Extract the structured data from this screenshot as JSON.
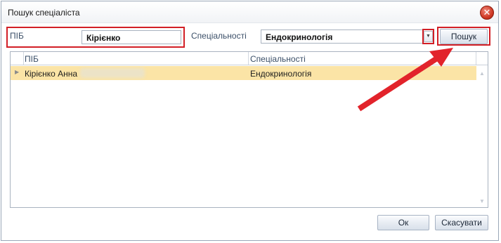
{
  "window": {
    "title": "Пошук спеціаліста",
    "close_icon": "close-icon"
  },
  "search": {
    "name_label": "ПІБ",
    "name_value": "Кірієнко",
    "specialty_label": "Спеціальності",
    "specialty_value": "Ендокринологія",
    "search_button": "Пошук"
  },
  "grid": {
    "columns": [
      "ПІБ",
      "Спеціальності"
    ],
    "rows": [
      {
        "name": "Кірієнко Анна",
        "specialty": "Ендокринологія",
        "selected": true
      }
    ]
  },
  "footer": {
    "ok_label": "Ок",
    "cancel_label": "Скасувати"
  },
  "colors": {
    "selected_row": "#fbe4a6",
    "highlight": "#d21f26",
    "accent_label": "#3b4f68"
  }
}
